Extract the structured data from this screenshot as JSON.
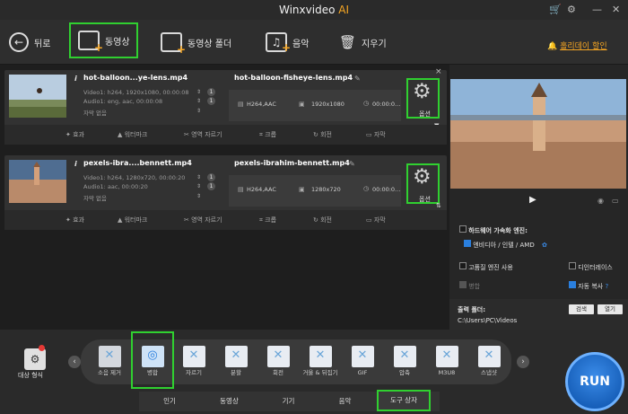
{
  "window": {
    "title": "Winxvideo",
    "title_ai": "AI"
  },
  "toolbar": {
    "back": "뒤로",
    "video": "동영상",
    "video_folder": "동영상 폴더",
    "music": "음악",
    "clear": "지우기",
    "promo": "홀리데이 할인",
    "promo_icon": "bell-icon"
  },
  "tasks": [
    {
      "source_name": "hot-balloon...ye-lens.mp4",
      "video_info": "Video1: h264, 1920x1080, 00:00:08",
      "audio_info": "Audio1: eng, aac, 00:00:08",
      "subtitle": "자막 없음",
      "output_name": "hot-balloon-fisheye-lens.mp4",
      "codec": "H264,AAC",
      "resolution": "1920x1080",
      "duration": "00:00:0...",
      "option_label": "옵션",
      "edits": [
        "효과",
        "워터마크",
        "영역 자르기",
        "크롭",
        "회전",
        "자막"
      ]
    },
    {
      "source_name": "pexels-ibra....bennett.mp4",
      "video_info": "Video1: h264, 1280x720, 00:00:20",
      "audio_info": "Audio1: aac, 00:00:20",
      "subtitle": "자막 없음",
      "output_name": "pexels-ibrahim-bennett.mp4",
      "codec": "H264,AAC",
      "resolution": "1280x720",
      "duration": "00:00:0...",
      "option_label": "옵션",
      "edits": [
        "효과",
        "워터마크",
        "영역 자르기",
        "크롭",
        "회전",
        "자막"
      ]
    }
  ],
  "right_panel": {
    "hw_accel": "하드웨어 가속화 엔진:",
    "hw_engine": "엔비디아 / 인텔 / AMD",
    "hq_engine": "고품질 엔진 사용",
    "deinterlace": "디인터레이스",
    "merge": "병합",
    "auto_copy": "자동 복사",
    "help": "?"
  },
  "output": {
    "label": "출력 폴더:",
    "path": "C:\\Users\\PC\\Videos",
    "browse": "검색",
    "open": "열기"
  },
  "bottom": {
    "target_format": "대상 형식",
    "tools": [
      "소음 제거",
      "병합",
      "자르기",
      "분할",
      "회전",
      "거울 & 뒤집기",
      "GIF",
      "압축",
      "M3U8",
      "스냅샷"
    ],
    "tabs": [
      "인기",
      "동영상",
      "기기",
      "음악",
      "도구 상자"
    ],
    "run": "RUN"
  },
  "colors": {
    "accent_green": "#30d030",
    "accent_orange": "#f6a623",
    "run_blue": "#1f6fd6"
  }
}
